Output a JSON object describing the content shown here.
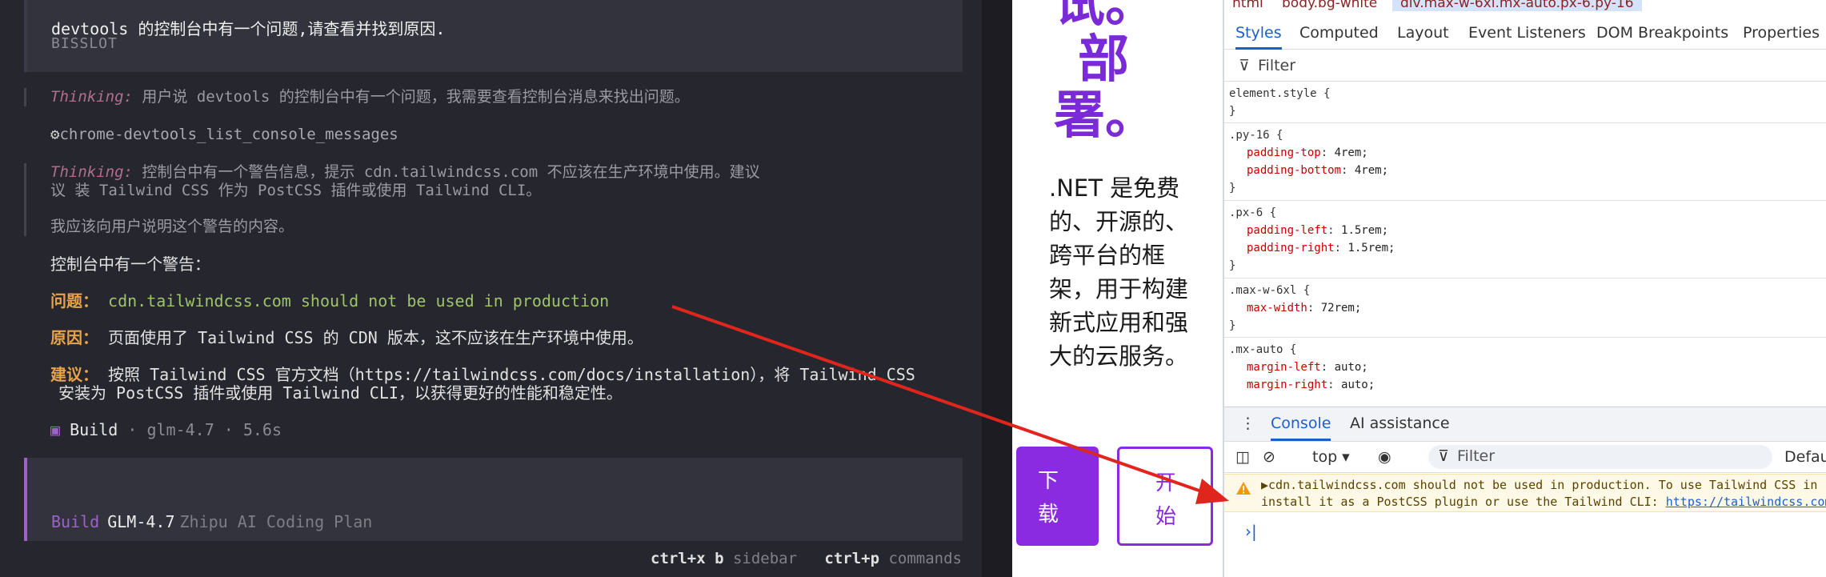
{
  "terminal": {
    "user_message": "devtools 的控制台中有一个问题,请查看并找到原因.",
    "user_name": "BISSLOT",
    "thinking_label": "Thinking:",
    "thinking_1": "用户说 devtools 的控制台中有一个问题，我需要查看控制台消息来找出问题。",
    "tool_call": "chrome-devtools_list_console_messages",
    "thinking_2_line1": "控制台中有一个警告信息，提示 cdn.tailwindcss.com 不应该在生产环境中使用。建议",
    "thinking_2_line2": "装 Tailwind CSS 作为 PostCSS 插件或使用 Tailwind CLI。",
    "thinking_2_line3": "我应该向用户说明这个警告的内容。",
    "answer_intro": "控制台中有一个警告：",
    "problem_label": "问题：",
    "problem_text": "cdn.tailwindcss.com should not be used in production",
    "cause_label": "原因：",
    "cause_text": "页面使用了 Tailwind CSS 的 CDN 版本，这不应该在生产环境中使用。",
    "suggest_label": "建议：",
    "suggest_line1": "按照 Tailwind CSS 官方文档（https://tailwindcss.com/docs/installation），将 Tailwind CSS",
    "suggest_line2": "安装为 PostCSS 插件或使用 Tailwind CLI，以获得更好的性能和稳定性。",
    "build_label": "Build",
    "build_meta": "· glm-4.7 · 5.6s",
    "agent_mode": "Build",
    "agent_model": "GLM-4.7",
    "agent_provider": "Zhipu AI Coding Plan",
    "hint_1_key": "ctrl+x b",
    "hint_1_label": "sidebar",
    "hint_2_key": "ctrl+p",
    "hint_2_label": "commands"
  },
  "page": {
    "hero_line1": "试。",
    "hero_line2": "部",
    "hero_line3": "署。",
    "description": ".NET 是免费的、开源的、跨平台的框架，用于构建新式应用和强大的云服务。",
    "download_button": "下载",
    "start_button": "开始"
  },
  "devtools": {
    "crumb_1": "html",
    "crumb_2": "body.bg-white",
    "crumb_3": "div.max-w-6xl.mx-auto.px-6.py-16",
    "tabs": [
      "Styles",
      "Computed",
      "Layout",
      "Event Listeners",
      "DOM Breakpoints",
      "Properties"
    ],
    "filter_placeholder": "Filter",
    "rules": [
      {
        "selector": "element.style {",
        "props": []
      },
      {
        "selector": ".py-16 {",
        "props": [
          [
            "padding-top",
            "4rem;"
          ],
          [
            "padding-bottom",
            "4rem;"
          ]
        ]
      },
      {
        "selector": ".px-6 {",
        "props": [
          [
            "padding-left",
            "1.5rem;"
          ],
          [
            "padding-right",
            "1.5rem;"
          ]
        ]
      },
      {
        "selector": ".max-w-6xl {",
        "props": [
          [
            "max-width",
            "72rem;"
          ]
        ]
      },
      {
        "selector": ".mx-auto {",
        "props": [
          [
            "margin-left",
            "auto;"
          ],
          [
            "margin-right",
            "auto;"
          ]
        ]
      }
    ],
    "drawer_tab_console": "Console",
    "drawer_tab_ai": "AI assistance",
    "context": "top ▾",
    "console_filter": "Filter",
    "levels": "Defau",
    "warning_line1": "▶cdn.tailwindcss.com should not be used in production. To use Tailwind CSS in",
    "warning_line2": "install it as a PostCSS plugin or use the Tailwind CLI: ",
    "warning_link": "https://tailwindcss.com",
    "prompt": "›|"
  },
  "colors": {
    "accent": "#8a2be2",
    "warning_bg": "#fef9e6",
    "arrow": "#e0261c"
  }
}
